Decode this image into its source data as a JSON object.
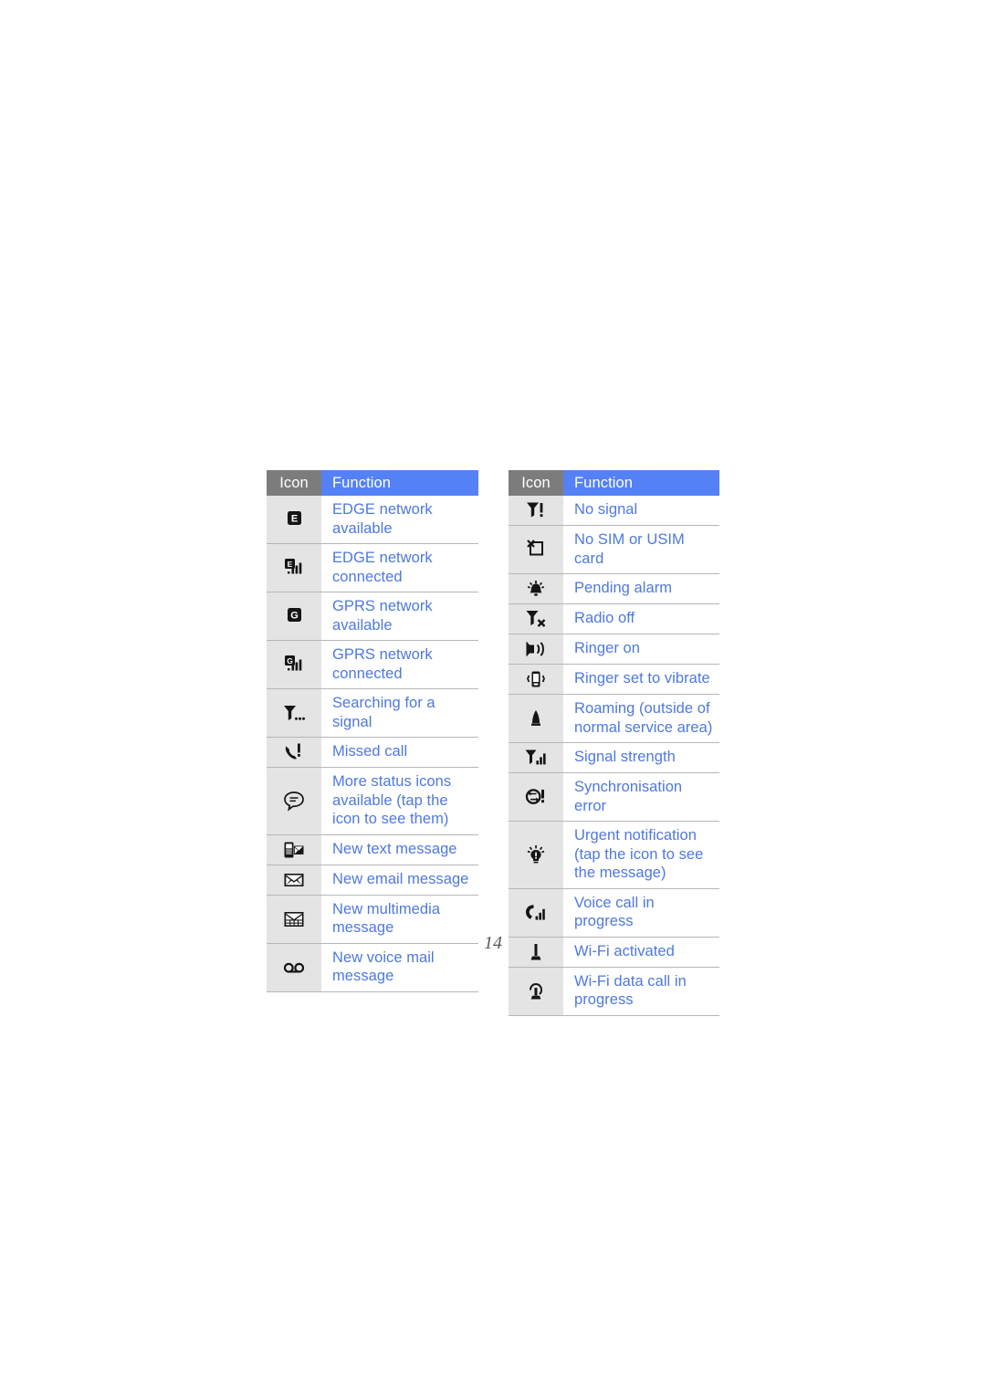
{
  "page": {
    "number": "14"
  },
  "tables": [
    {
      "id": "status-icons-table-left",
      "headers": {
        "icon": "Icon",
        "function": "Function"
      },
      "rows": [
        {
          "icon_name": "edge-available-icon",
          "label": "EDGE network available"
        },
        {
          "icon_name": "edge-connected-icon",
          "label": "EDGE network connected"
        },
        {
          "icon_name": "gprs-available-icon",
          "label": "GPRS network available"
        },
        {
          "icon_name": "gprs-connected-icon",
          "label": "GPRS network connected"
        },
        {
          "icon_name": "searching-signal-icon",
          "label": "Searching for a signal"
        },
        {
          "icon_name": "missed-call-icon",
          "label": "Missed call"
        },
        {
          "icon_name": "more-status-icons-icon",
          "label": "More status icons available (tap the icon to see them)"
        },
        {
          "icon_name": "new-text-message-icon",
          "label": "New text message"
        },
        {
          "icon_name": "new-email-message-icon",
          "label": "New email message"
        },
        {
          "icon_name": "new-mms-icon",
          "label": "New multimedia message"
        },
        {
          "icon_name": "new-voicemail-icon",
          "label": "New voice mail message"
        }
      ]
    },
    {
      "id": "status-icons-table-right",
      "headers": {
        "icon": "Icon",
        "function": "Function"
      },
      "rows": [
        {
          "icon_name": "no-signal-icon",
          "label": "No signal"
        },
        {
          "icon_name": "no-sim-card-icon",
          "label": "No SIM or USIM card"
        },
        {
          "icon_name": "pending-alarm-icon",
          "label": "Pending alarm"
        },
        {
          "icon_name": "radio-off-icon",
          "label": "Radio off"
        },
        {
          "icon_name": "ringer-on-icon",
          "label": "Ringer on"
        },
        {
          "icon_name": "ringer-vibrate-icon",
          "label": "Ringer set to vibrate"
        },
        {
          "icon_name": "roaming-icon",
          "label": "Roaming (outside of normal service area)"
        },
        {
          "icon_name": "signal-strength-icon",
          "label": "Signal strength"
        },
        {
          "icon_name": "sync-error-icon",
          "label": "Synchronisation error"
        },
        {
          "icon_name": "urgent-notification-icon",
          "label": "Urgent notification (tap the icon to see the message)"
        },
        {
          "icon_name": "voice-call-icon",
          "label": "Voice call in progress"
        },
        {
          "icon_name": "wifi-activated-icon",
          "label": "Wi-Fi activated"
        },
        {
          "icon_name": "wifi-data-call-icon",
          "label": "Wi-Fi data call in progress"
        }
      ]
    }
  ],
  "colors": {
    "header_icon_bg": "#7c7c7c",
    "header_function_bg": "#5481f5",
    "icon_cell_bg": "#e4e4e4",
    "function_text": "#4e78e0",
    "rule": "#b6b6b6"
  }
}
